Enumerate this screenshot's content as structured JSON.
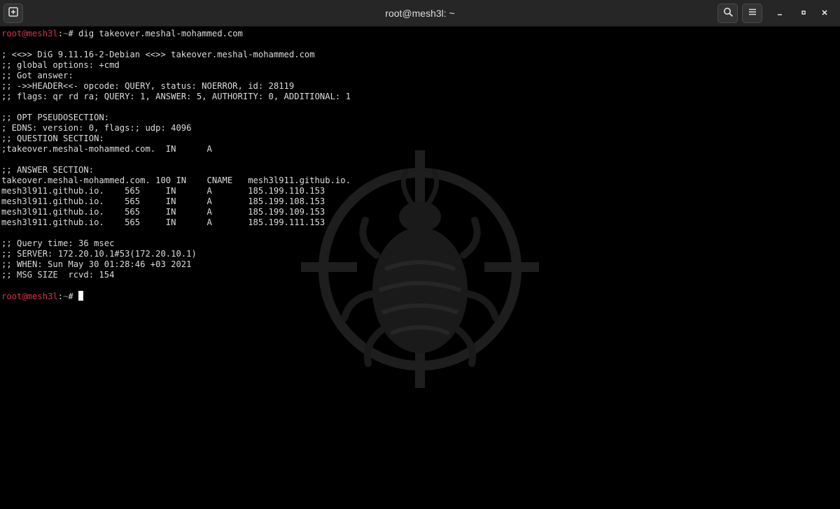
{
  "window": {
    "title": "root@mesh3l: ~"
  },
  "icons": {
    "new_tab": "new-tab-icon",
    "search": "search-icon",
    "menu": "hamburger-menu-icon",
    "minimize": "minimize-icon",
    "maximize": "maximize-icon",
    "close": "close-icon",
    "watermark": "bug-crosshair-logo"
  },
  "colors": {
    "background": "#000000",
    "titlebar": "#262626",
    "text": "#dcdcdc",
    "prompt_user": "#d6334a",
    "prompt_path": "#8a8a8a"
  },
  "terminal": {
    "prompt1": {
      "user": "root@mesh3l",
      "sep": ":",
      "path": "~",
      "symbol": "#",
      "command": " dig takeover.meshal-mohammed.com"
    },
    "lines": [
      "",
      "; <<>> DiG 9.11.16-2-Debian <<>> takeover.meshal-mohammed.com",
      ";; global options: +cmd",
      ";; Got answer:",
      ";; ->>HEADER<<- opcode: QUERY, status: NOERROR, id: 28119",
      ";; flags: qr rd ra; QUERY: 1, ANSWER: 5, AUTHORITY: 0, ADDITIONAL: 1",
      "",
      ";; OPT PSEUDOSECTION:",
      "; EDNS: version: 0, flags:; udp: 4096",
      ";; QUESTION SECTION:",
      ";takeover.meshal-mohammed.com.  IN      A",
      "",
      ";; ANSWER SECTION:",
      "takeover.meshal-mohammed.com. 100 IN    CNAME   mesh3l911.github.io.",
      "mesh3l911.github.io.    565     IN      A       185.199.110.153",
      "mesh3l911.github.io.    565     IN      A       185.199.108.153",
      "mesh3l911.github.io.    565     IN      A       185.199.109.153",
      "mesh3l911.github.io.    565     IN      A       185.199.111.153",
      "",
      ";; Query time: 36 msec",
      ";; SERVER: 172.20.10.1#53(172.20.10.1)",
      ";; WHEN: Sun May 30 01:28:46 +03 2021",
      ";; MSG SIZE  rcvd: 154",
      ""
    ],
    "prompt2": {
      "user": "root@mesh3l",
      "sep": ":",
      "path": "~",
      "symbol": "# "
    }
  }
}
